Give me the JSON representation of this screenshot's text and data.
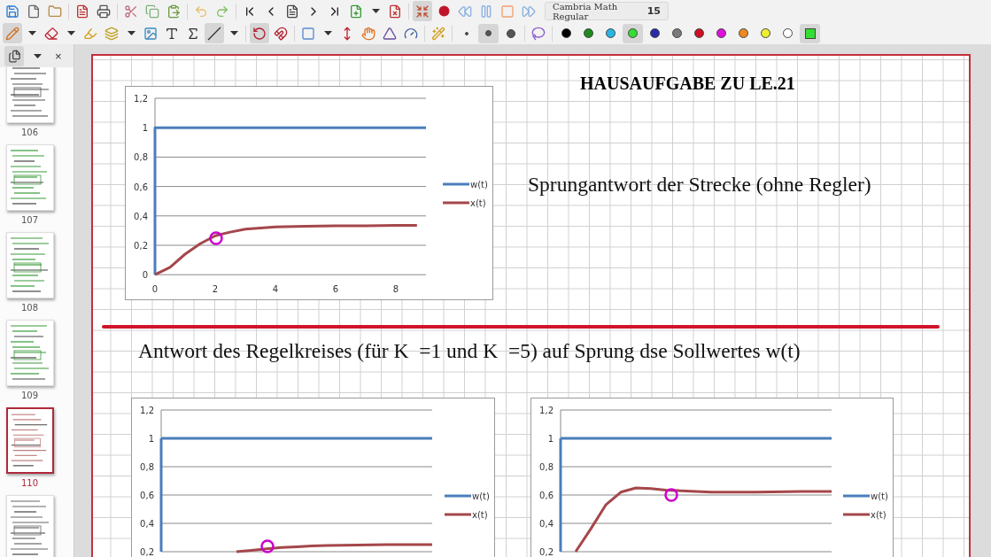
{
  "toolbar_top": [
    [
      {
        "kind": "save",
        "selected": false
      },
      {
        "kind": "new",
        "selected": false
      },
      {
        "kind": "open",
        "selected": false
      }
    ],
    [
      {
        "kind": "pdf",
        "selected": false
      },
      {
        "kind": "print",
        "selected": false
      }
    ],
    [
      {
        "kind": "cut",
        "selected": false
      },
      {
        "kind": "copy",
        "selected": false
      },
      {
        "kind": "paste",
        "selected": false
      }
    ],
    [
      {
        "kind": "undo",
        "selected": false
      },
      {
        "kind": "redo",
        "selected": false
      }
    ],
    [
      {
        "kind": "first",
        "selected": false
      },
      {
        "kind": "prev",
        "selected": false
      },
      {
        "kind": "page",
        "selected": false
      },
      {
        "kind": "next",
        "selected": false
      },
      {
        "kind": "last",
        "selected": false
      },
      {
        "kind": "addpage",
        "selected": false
      },
      {
        "kind": "caret",
        "selected": false
      },
      {
        "kind": "delpage",
        "selected": false
      }
    ],
    [
      {
        "kind": "fullscreen",
        "selected": true
      },
      {
        "kind": "record",
        "selected": false
      },
      {
        "kind": "rewind",
        "selected": false
      },
      {
        "kind": "pause",
        "selected": false
      },
      {
        "kind": "stop",
        "selected": false
      },
      {
        "kind": "forward",
        "selected": false
      }
    ]
  ],
  "font": {
    "name": "Cambria Math Regular",
    "size": "15"
  },
  "toolbar_tools": [
    [
      {
        "kind": "pen",
        "selected": true
      },
      {
        "kind": "caret",
        "selected": false
      },
      {
        "kind": "eraser",
        "selected": false
      },
      {
        "kind": "caret",
        "selected": false
      },
      {
        "kind": "marker",
        "selected": false
      },
      {
        "kind": "notes",
        "selected": false
      },
      {
        "kind": "caret",
        "selected": false
      },
      {
        "kind": "image",
        "selected": false
      },
      {
        "kind": "text",
        "selected": false
      },
      {
        "kind": "formula",
        "selected": false
      },
      {
        "kind": "line",
        "selected": true
      },
      {
        "kind": "caret",
        "selected": false
      }
    ],
    [
      {
        "kind": "rotate",
        "selected": true
      },
      {
        "kind": "magnet",
        "selected": false
      }
    ],
    [
      {
        "kind": "rectangle",
        "selected": false
      },
      {
        "kind": "caret",
        "selected": false
      },
      {
        "kind": "height",
        "selected": false
      },
      {
        "kind": "hand",
        "selected": false
      },
      {
        "kind": "setsquare",
        "selected": false
      },
      {
        "kind": "protractor",
        "selected": false
      }
    ],
    [
      {
        "kind": "wand",
        "selected": false
      }
    ]
  ],
  "pen_sizes": [
    {
      "selected": false
    },
    {
      "selected": true
    },
    {
      "selected": false
    }
  ],
  "lasso": {
    "selected": false
  },
  "colors": [
    {
      "color": "#000000",
      "selected": false
    },
    {
      "color": "#1f8a1f",
      "selected": false
    },
    {
      "color": "#2bb5e0",
      "selected": false
    },
    {
      "color": "#33dd33",
      "selected": true
    },
    {
      "color": "#2a2aa8",
      "selected": false
    },
    {
      "color": "#7a7a7a",
      "selected": false
    },
    {
      "color": "#cc1122",
      "selected": false
    },
    {
      "color": "#dd11dd",
      "selected": false
    },
    {
      "color": "#ee8822",
      "selected": false
    },
    {
      "color": "#eeee33",
      "selected": false
    },
    {
      "color": "#ffffff",
      "selected": false
    }
  ],
  "fill": {
    "color": "#33dd33",
    "selected": true
  },
  "sidebar": {
    "close": "×",
    "thumbnails": [
      {
        "label": "106",
        "selected": false
      },
      {
        "label": "107",
        "selected": false
      },
      {
        "label": "108",
        "selected": false
      },
      {
        "label": "109",
        "selected": false
      },
      {
        "label": "110",
        "selected": true
      },
      {
        "selected": false
      }
    ]
  },
  "page": {
    "title": "HAUSAUFGABE ZU LE.21",
    "subtitle": "Sprungantwort der Strecke (ohne Regler)",
    "caption": "Antwort des Regelkreises (für K  =1 und K  =5) auf Sprung dse Sollwertes w(t)",
    "charts": [
      {
        "chart_data": {
          "type": "line",
          "x": [
            0,
            0,
            0.5,
            1,
            1.5,
            2,
            2.5,
            3,
            4,
            5,
            6,
            7,
            8,
            8.7,
            9
          ],
          "xlim": [
            0,
            9
          ],
          "ylim": [
            0,
            1.2
          ],
          "xticks": [
            0,
            2,
            4,
            6,
            8
          ],
          "yticks": [
            {
              "value": 0,
              "label": "0"
            },
            {
              "value": 0.2,
              "label": "0,2"
            },
            {
              "value": 0.4,
              "label": "0,4"
            },
            {
              "value": 0.6,
              "label": "0,6"
            },
            {
              "value": 0.8,
              "label": "0,8"
            },
            {
              "value": 1,
              "label": "1"
            },
            {
              "value": 1.2,
              "label": "1,2"
            }
          ],
          "grid": true,
          "legend": true,
          "series": [
            {
              "name": "w(t)",
              "color": "#4a7ebb",
              "values": [
                0,
                1,
                1,
                1,
                1,
                1,
                1,
                1,
                1,
                1,
                1,
                1,
                1,
                1,
                1
              ]
            },
            {
              "name": "x(t)",
              "color": "#a5474b",
              "values": [
                0,
                0,
                0.05,
                0.14,
                0.21,
                0.265,
                0.29,
                0.31,
                0.325,
                0.33,
                0.333,
                0.333,
                0.335,
                0.335,
                null
              ]
            }
          ]
        }
      },
      {
        "chart_data": {
          "type": "line",
          "categories": [
            null,
            null,
            null,
            null,
            null,
            null,
            null,
            null,
            null,
            null,
            null,
            null,
            null,
            null,
            null,
            null,
            null,
            null,
            null
          ],
          "ylim": [
            0.2,
            1.2
          ],
          "yticks": [
            {
              "value": 0.2,
              "label": "0,2"
            },
            {
              "value": 0.4,
              "label": "0,4"
            },
            {
              "value": 0.6,
              "label": "0,6"
            },
            {
              "value": 0.8,
              "label": "0,8"
            },
            {
              "value": 1,
              "label": "1"
            },
            {
              "value": 1.2,
              "label": "1,2"
            }
          ],
          "grid": true,
          "legend": true,
          "series": [
            {
              "name": "w(t)",
              "color": "#4a7ebb",
              "values": [
                1,
                1,
                1,
                1,
                1,
                1,
                1,
                1,
                1,
                1,
                1,
                1,
                1,
                1,
                1,
                1,
                1,
                1,
                1
              ]
            },
            {
              "name": "x(t)",
              "color": "#a5474b",
              "values": [
                null,
                null,
                null,
                null,
                null,
                0.2,
                0.21,
                0.22,
                0.23,
                0.235,
                0.24,
                0.243,
                0.245,
                0.247,
                0.248,
                0.25,
                0.25,
                0.25,
                0.25
              ]
            }
          ]
        }
      },
      {
        "chart_data": {
          "type": "line",
          "categories": [
            null,
            null,
            null,
            null,
            null,
            null,
            null,
            null,
            null,
            null,
            null,
            null,
            null,
            null,
            null,
            null,
            null,
            null,
            null
          ],
          "ylim": [
            0.2,
            1.2
          ],
          "yticks": [
            {
              "value": 0.2,
              "label": "0,2"
            },
            {
              "value": 0.4,
              "label": "0,4"
            },
            {
              "value": 0.6,
              "label": "0,6"
            },
            {
              "value": 0.8,
              "label": "0,8"
            },
            {
              "value": 1,
              "label": "1"
            },
            {
              "value": 1.2,
              "label": "1,2"
            }
          ],
          "grid": true,
          "legend": true,
          "series": [
            {
              "name": "w(t)",
              "color": "#4a7ebb",
              "values": [
                1,
                1,
                1,
                1,
                1,
                1,
                1,
                1,
                1,
                1,
                1,
                1,
                1,
                1,
                1,
                1,
                1,
                1,
                1
              ]
            },
            {
              "name": "x(t)",
              "color": "#a5474b",
              "values": [
                null,
                0.2,
                0.36,
                0.53,
                0.62,
                0.65,
                0.645,
                0.635,
                0.63,
                0.625,
                0.62,
                0.62,
                0.62,
                0.62,
                0.622,
                0.623,
                0.625,
                0.625,
                0.625
              ]
            }
          ]
        }
      }
    ],
    "ink_marks": [
      {
        "kind": "circle",
        "color": "#cc00cc"
      },
      {
        "kind": "circle",
        "color": "#cc00cc"
      },
      {
        "kind": "circle",
        "color": "#cc00cc"
      }
    ]
  }
}
